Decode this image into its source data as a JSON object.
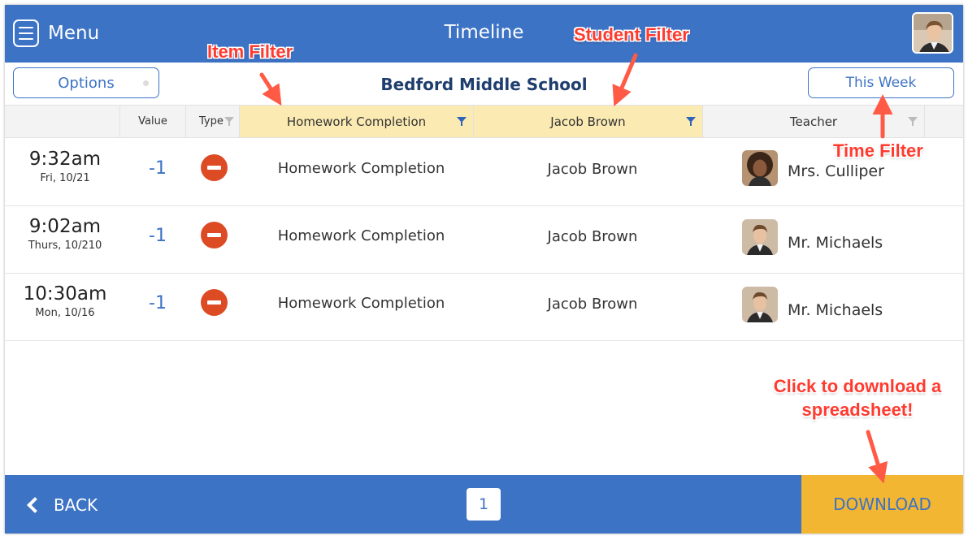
{
  "topbar": {
    "menu_label": "Menu",
    "title": "Timeline"
  },
  "filters": {
    "options_label": "Options",
    "school": "Bedford Middle School",
    "time_filter": "This Week"
  },
  "columns": {
    "value": "Value",
    "type": "Type",
    "item": "Homework Completion",
    "student": "Jacob Brown",
    "teacher": "Teacher"
  },
  "rows": [
    {
      "time": "9:32am",
      "date": "Fri, 10/21",
      "value": "-1",
      "item": "Homework Completion",
      "student": "Jacob Brown",
      "teacher": "Mrs. Culliper"
    },
    {
      "time": "9:02am",
      "date": "Thurs, 10/210",
      "value": "-1",
      "item": "Homework Completion",
      "student": "Jacob Brown",
      "teacher": "Mr. Michaels"
    },
    {
      "time": "10:30am",
      "date": "Mon, 10/16",
      "value": "-1",
      "item": "Homework Completion",
      "student": "Jacob Brown",
      "teacher": "Mr. Michaels"
    }
  ],
  "footer": {
    "back_label": "BACK",
    "page": "1",
    "download_label": "DOWNLOAD"
  },
  "annotations": {
    "item_filter": "Item Filter",
    "student_filter": "Student  Filter",
    "time_filter": "Time Filter",
    "download_line1": "Click to download a",
    "download_line2": "spreadsheet!"
  },
  "colors": {
    "primary": "#3d73c5",
    "selected_header": "#fbeab2",
    "negative_icon": "#dd4b25",
    "download": "#f2b632",
    "annotation": "#ff3b30"
  },
  "icons": {
    "menu": "menu-icon",
    "type": "minus-circle-icon",
    "filter": "funnel-icon",
    "back": "chevron-left-icon"
  }
}
